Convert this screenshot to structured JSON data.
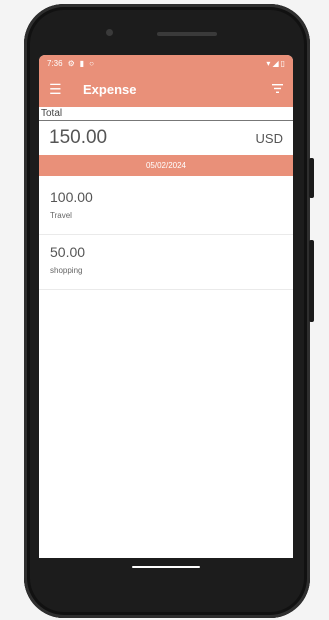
{
  "status_bar": {
    "time": "7:36",
    "icons": [
      "settings-icon",
      "sd-card-icon",
      "sync-icon"
    ],
    "right_icons": [
      "wifi-icon",
      "signal-icon",
      "battery-icon"
    ]
  },
  "app_bar": {
    "title": "Expense",
    "menu_icon": "menu-icon",
    "filter_icon": "filter-icon"
  },
  "summary": {
    "label": "Total",
    "amount": "150.00",
    "currency": "USD"
  },
  "date_header": "05/02/2024",
  "expenses": [
    {
      "amount": "100.00",
      "category": "Travel"
    },
    {
      "amount": "50.00",
      "category": "shopping"
    }
  ],
  "colors": {
    "accent": "#e99079"
  }
}
